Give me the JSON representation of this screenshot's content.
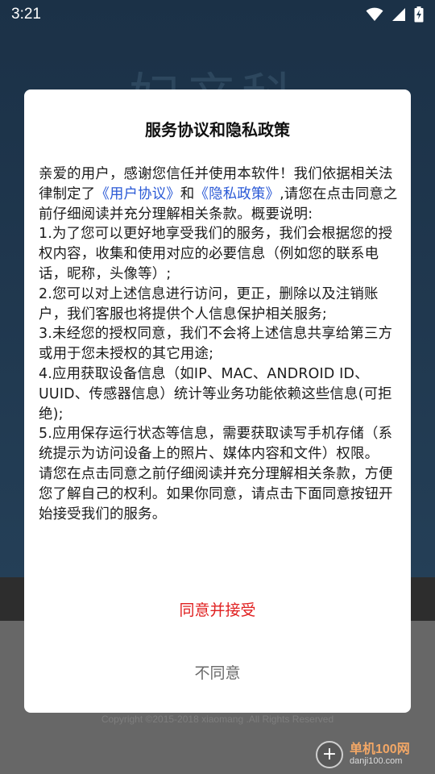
{
  "status_bar": {
    "time": "3:21",
    "icons": [
      "wifi-icon",
      "signal-icon",
      "battery-charging-icon"
    ]
  },
  "background": {
    "watermark_text": "妇产科",
    "copyright": "Copyright ©2015-2018 xiaomang .All Rights Reserved",
    "site_badge": {
      "name": "单机100网",
      "domain": "danji100.com"
    }
  },
  "dialog": {
    "title": "服务协议和隐私政策",
    "intro_before": "亲爱的用户，感谢您信任并使用本软件！我们依据相关法律制定了",
    "link_user_agreement": "《用户协议》",
    "and": "和",
    "link_privacy_policy": "《隐私政策》",
    "intro_after": ",请您在点击同意之前仔细阅读并充分理解相关条款。概要说明:",
    "items": [
      "1.为了您可以更好地享受我们的服务，我们会根据您的授权内容，收集和使用对应的必要信息（例如您的联系电话，昵称，头像等）;",
      "2.您可以对上述信息进行访问，更正，删除以及注销账户，我们客服也将提供个人信息保护相关服务;",
      "3.未经您的授权同意，我们不会将上述信息共享给第三方或用于您未授权的其它用途;",
      "4.应用获取设备信息（如IP、MAC、ANDROID ID、UUID、传感器信息）统计等业务功能依赖这些信息(可拒绝);",
      "5.应用保存运行状态等信息，需要获取读写手机存储（系统提示为访问设备上的照片、媒体内容和文件）权限。"
    ],
    "closing": "请您在点击同意之前仔细阅读并充分理解相关条款，方便您了解自己的权利。如果你同意，请点击下面同意按钮开始接受我们的服务。",
    "accept_label": "同意并接受",
    "reject_label": "不同意"
  },
  "colors": {
    "accent_red": "#e02020",
    "link_blue": "#2a59d6"
  }
}
